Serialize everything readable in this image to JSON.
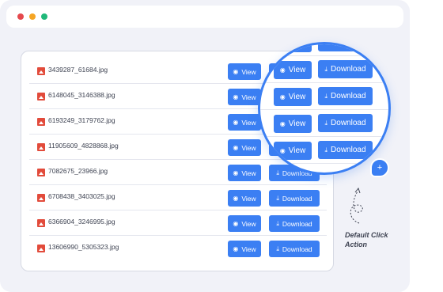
{
  "window": {
    "colors": {
      "close": "#e5484d",
      "minimize": "#f5a524",
      "maximize": "#1fb879"
    }
  },
  "files": [
    {
      "name": "3439287_61684.jpg"
    },
    {
      "name": "6148045_3146388.jpg"
    },
    {
      "name": "6193249_3179762.jpg"
    },
    {
      "name": "11905609_4828868.jpg"
    },
    {
      "name": "7082675_23966.jpg"
    },
    {
      "name": "6708438_3403025.jpg"
    },
    {
      "name": "6366904_3246995.jpg"
    },
    {
      "name": "13606990_5305323.jpg"
    }
  ],
  "actions": {
    "view_label": "View",
    "download_label": "Download",
    "view_icon": "eye-icon",
    "download_icon": "download-icon",
    "file_icon": "image-file-icon"
  },
  "magnifier": {
    "view_label": "View",
    "download_label": "Download",
    "badge_icon": "plus-icon",
    "badge_symbol": "+"
  },
  "annotation": {
    "line1": "Default Click",
    "line2": "Action"
  },
  "theme": {
    "accent": "#3b7ff3",
    "file_icon_color": "#e24b3b"
  }
}
